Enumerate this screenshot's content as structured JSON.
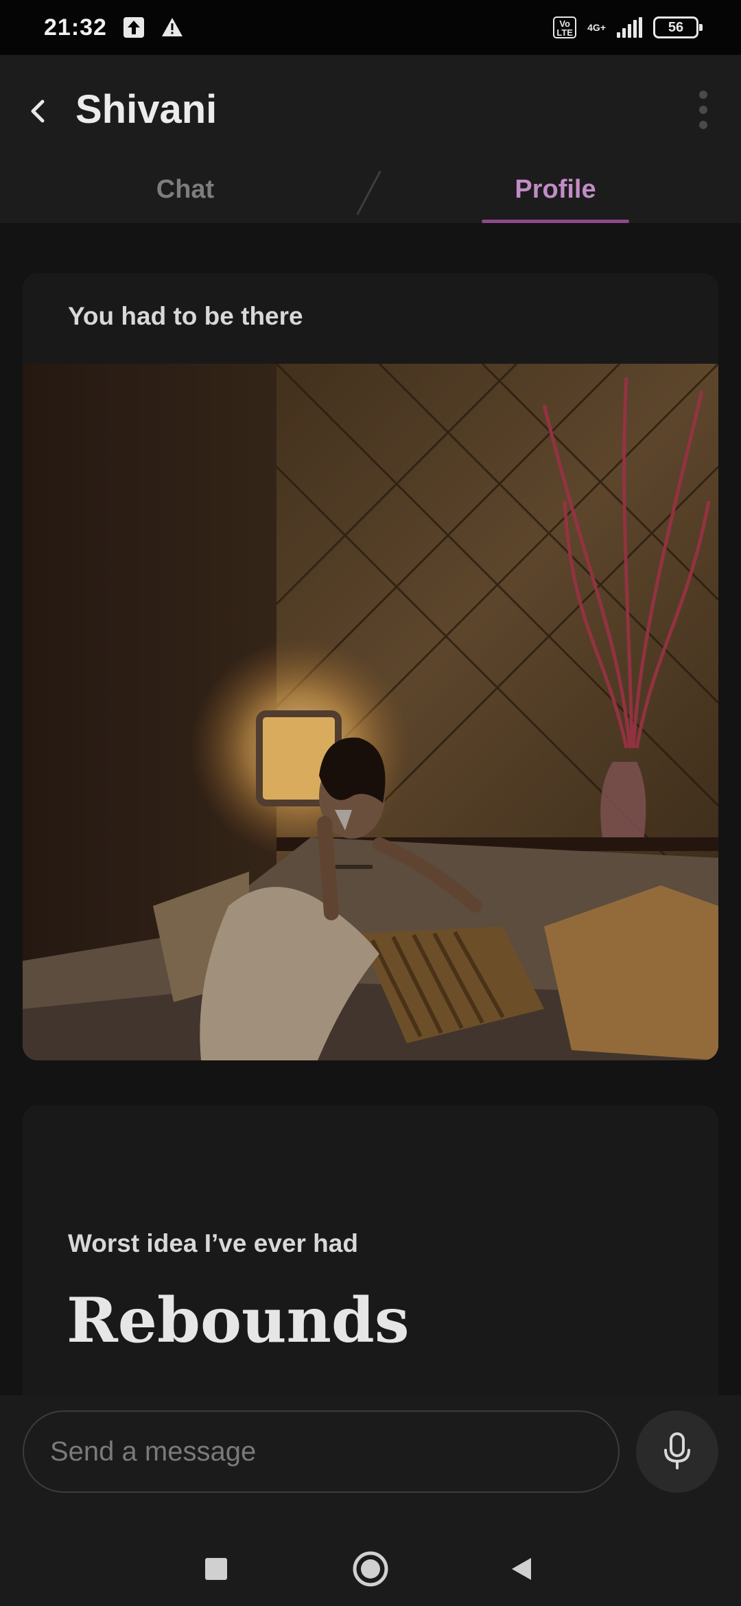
{
  "status_bar": {
    "time": "21:32",
    "network_badge": "Vo\nLTE",
    "network_type": "4G+",
    "battery_level": "56"
  },
  "header": {
    "title": "Shivani",
    "tabs": [
      {
        "label": "Chat",
        "active": false
      },
      {
        "label": "Profile",
        "active": true
      }
    ]
  },
  "profile": {
    "cards": [
      {
        "prompt": "You had to be there",
        "photo": "profile-photo-lounge"
      },
      {
        "prompt": "Worst idea I’ve ever had",
        "answer": "Rebounds"
      }
    ]
  },
  "composer": {
    "placeholder": "Send a message",
    "value": ""
  },
  "colors": {
    "accent": "#c28cc6",
    "accent_underline": "#8d4a8b",
    "background": "#131313",
    "card": "#191919"
  },
  "icons": {
    "back": "chevron-left-icon",
    "more": "more-vertical-icon",
    "mic": "microphone-icon",
    "nav_recent": "square-icon",
    "nav_home": "circle-icon",
    "nav_back": "triangle-back-icon"
  }
}
